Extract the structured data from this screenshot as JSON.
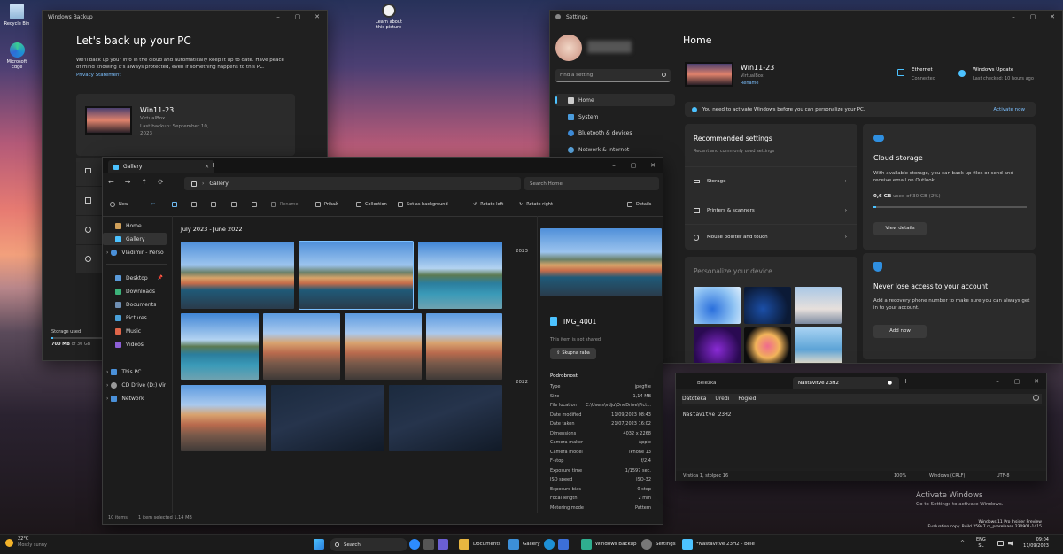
{
  "desktop": {
    "icons": [
      {
        "label": "Recycle Bin"
      },
      {
        "label": "Microsoft Edge"
      },
      {
        "label": "Learn about this picture"
      }
    ],
    "watermark_title": "Activate Windows",
    "watermark_sub": "Go to Settings to activate Windows.",
    "build_line1": "Windows 11 Pro Insider Preview",
    "build_line2": "Evaluation copy. Build 25947.rs_prerelease.230901-1415"
  },
  "backup": {
    "title": "Windows Backup",
    "heading": "Let's back up your PC",
    "desc": "We'll back up your info in the cloud and automatically keep it up to date. Have peace of mind knowing it's always protected, even if something happens to this PC.",
    "privacy": "Privacy Statement",
    "device_name": "Win11-23",
    "device_sub": "VirtualBox",
    "last_backup": "Last backup: September 10, 2023",
    "storage_label": "Storage used",
    "storage_value": "700 MB",
    "storage_of": "of 30 GB"
  },
  "gallery": {
    "tab": "Gallery",
    "address": "Gallery",
    "search_placeholder": "Search Home",
    "toolbar": {
      "new": "New",
      "rename": "Rename",
      "share": "Prikaži",
      "collection": "Collection",
      "set_bg": "Set as background",
      "rotate_left": "Rotate left",
      "rotate_right": "Rotate right",
      "more": "···",
      "details": "Details"
    },
    "nav": {
      "home": "Home",
      "gallery": "Gallery",
      "personal": "Vladimir - Personal",
      "desktop": "Desktop",
      "downloads": "Downloads",
      "documents": "Documents",
      "pictures": "Pictures",
      "music": "Music",
      "videos": "Videos",
      "thispc": "This PC",
      "cddrive": "CD Drive (D:) Virtua",
      "network": "Network"
    },
    "section": "July 2023 - June 2022",
    "years": {
      "top": "2023",
      "mid": "2022"
    },
    "status_items": "10 items",
    "status_selected": "1 item selected  1,14 MB",
    "file_name": "IMG_4001",
    "share_state": "This item is not shared",
    "share_button": "Skupna raba",
    "details_heading": "Podrobnosti",
    "details": [
      {
        "k": "Type",
        "v": "jpegfile"
      },
      {
        "k": "Size",
        "v": "1,14 MB"
      },
      {
        "k": "File location",
        "v": "C:\\Users\\vdju\\OneDrive\\Pict..."
      },
      {
        "k": "Date modified",
        "v": "11/09/2023 08:43"
      },
      {
        "k": "Date taken",
        "v": "21/07/2023 16:02"
      },
      {
        "k": "Dimensions",
        "v": "4032 x 2268"
      },
      {
        "k": "Camera maker",
        "v": "Apple"
      },
      {
        "k": "Camera model",
        "v": "iPhone 13"
      },
      {
        "k": "F-stop",
        "v": "f/2.4"
      },
      {
        "k": "Exposure time",
        "v": "1/1597 sec."
      },
      {
        "k": "ISO speed",
        "v": "ISO-32"
      },
      {
        "k": "Exposure bias",
        "v": "0 step"
      },
      {
        "k": "Focal length",
        "v": "2 mm"
      },
      {
        "k": "Metering mode",
        "v": "Pattern"
      }
    ]
  },
  "settings": {
    "title": "Settings",
    "search_placeholder": "Find a setting",
    "nav": [
      "Home",
      "System",
      "Bluetooth & devices",
      "Network & internet"
    ],
    "page_title": "Home",
    "device_name": "Win11-23",
    "device_sub": "VirtualBox",
    "rename": "Rename",
    "ethernet": "Ethernet",
    "ethernet_state": "Connected",
    "update": "Windows Update",
    "update_state": "Last checked: 10 hours ago",
    "activate_msg": "You need to activate Windows before you can personalize your PC.",
    "activate_link": "Activate now",
    "rec_title": "Recommended settings",
    "rec_sub": "Recent and commonly used settings",
    "rec_items": [
      "Storage",
      "Printers & scanners",
      "Mouse pointer and touch"
    ],
    "personalize": "Personalize your device",
    "cloud_title": "Cloud storage",
    "cloud_desc": "With available storage, you can back up files or send and receive email on Outlook.",
    "cloud_usage_value": "0,6 GB",
    "cloud_usage_rest": "used of 30 GB (2%)",
    "cloud_usage_fraction": 0.02,
    "cloud_btn": "View details",
    "account_title": "Never lose access to your account",
    "account_desc": "Add a recovery phone number to make sure you can always get in to your account.",
    "account_btn": "Add now"
  },
  "notepad": {
    "tab1": "Beležka",
    "tab2": "Nastavitve 23H2",
    "menu": [
      "Datoteka",
      "Uredi",
      "Pogled"
    ],
    "content": "Nastavitve 23H2",
    "status_pos": "Vrstica 1, stolpec 16",
    "zoom": "100%",
    "eol": "Windows (CRLF)",
    "enc": "UTF-8"
  },
  "taskbar": {
    "weather_temp": "22°C",
    "weather_desc": "Mostly sunny",
    "search": "Search",
    "apps": [
      "Documents",
      "Gallery",
      "Windows Backup",
      "Settings",
      "*Nastavitve 23H2 - bele"
    ],
    "lang1": "ENG",
    "lang2": "SL",
    "time": "09:04",
    "date": "11/09/2023"
  },
  "colors": {
    "accent": "#4cc2ff",
    "link": "#7cc0ff"
  }
}
